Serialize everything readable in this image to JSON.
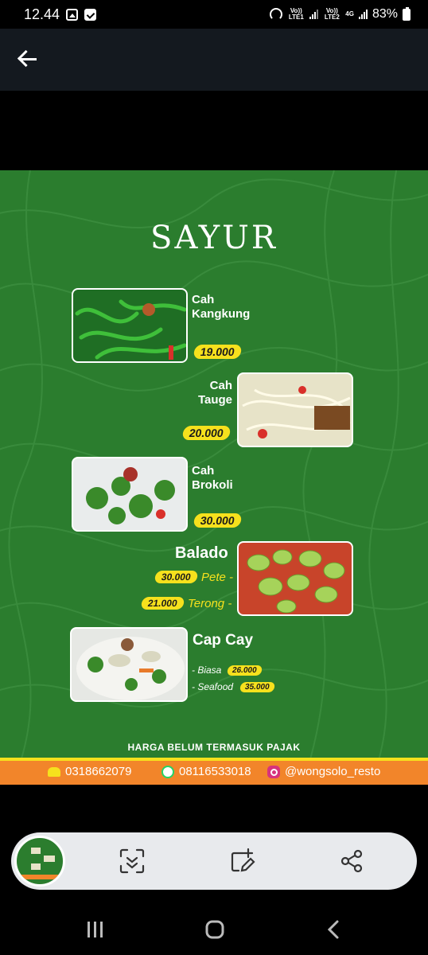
{
  "status_bar": {
    "time": "12.44",
    "sim1": "Vo)) LTE1",
    "sim2": "Vo)) LTE2",
    "network": "4G",
    "battery": "83%"
  },
  "header": {
    "back_icon": "arrow-left-icon"
  },
  "menu": {
    "title": "SAYUR",
    "items": [
      {
        "name_line1": "Cah",
        "name_line2": "Kangkung",
        "price": "19.000"
      },
      {
        "name_line1": "Cah",
        "name_line2": "Tauge",
        "price": "20.000"
      },
      {
        "name_line1": "Cah",
        "name_line2": "Brokoli",
        "price": "30.000"
      },
      {
        "name": "Balado",
        "variants": [
          {
            "label": "Pete -",
            "price": "30.000"
          },
          {
            "label": "Terong -",
            "price": "21.000"
          }
        ]
      },
      {
        "name": "Cap Cay",
        "variants": [
          {
            "label": "- Biasa",
            "price": "26.000"
          },
          {
            "label": "- Seafood",
            "price": "35.000"
          }
        ]
      }
    ],
    "tax_note": "HARGA BELUM TERMASUK PAJAK",
    "contacts": {
      "phone": "0318662079",
      "whatsapp": "08116533018",
      "instagram": "@wongsolo_resto"
    }
  },
  "toolbar": {
    "buttons": [
      "scan-text-icon",
      "edit-image-icon",
      "share-icon"
    ]
  },
  "nav": {
    "buttons": [
      "recents-icon",
      "home-icon",
      "back-icon"
    ]
  },
  "colors": {
    "menu_green": "#2b7d2e",
    "price_yellow": "#f6e11d",
    "contact_orange": "#f2852a"
  }
}
